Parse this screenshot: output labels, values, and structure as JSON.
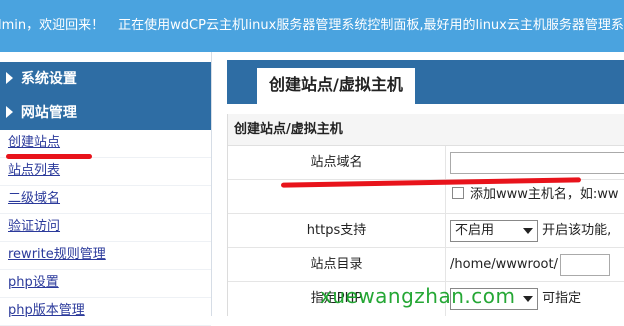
{
  "topbar": {
    "welcome": "lmin，欢迎回来！",
    "notice": "正在使用wdCP云主机linux服务器管理系统控制面板,最好用的linux云主机服务器管理系"
  },
  "sidebar": {
    "sections": [
      {
        "label": "系统设置"
      },
      {
        "label": "网站管理"
      }
    ],
    "items": [
      {
        "label": "创建站点"
      },
      {
        "label": "站点列表"
      },
      {
        "label": "二级域名"
      },
      {
        "label": "验证访问"
      },
      {
        "label": "rewrite规则管理"
      },
      {
        "label": "php设置"
      },
      {
        "label": "php版本管理"
      }
    ]
  },
  "main": {
    "title": "创建站点/虚拟主机",
    "panel_title": "创建站点/虚拟主机",
    "fields": {
      "domain_label": "站点域名",
      "domain_value": "",
      "www_checkbox_text": "添加www主机名，如:ww",
      "https_label": "https支持",
      "https_selected": "不启用",
      "https_hint": "开启该功能,",
      "dir_label": "站点目录",
      "dir_value": "/home/wwwroot/",
      "php_label": "指定PHP",
      "php_hint": "可指定"
    }
  },
  "watermark": "xuewangzhan.com",
  "colors": {
    "topbar": "#4aa3df",
    "section_header": "#2e6da4",
    "highlight": "#e8131b",
    "watermark": "#1aa32b"
  }
}
